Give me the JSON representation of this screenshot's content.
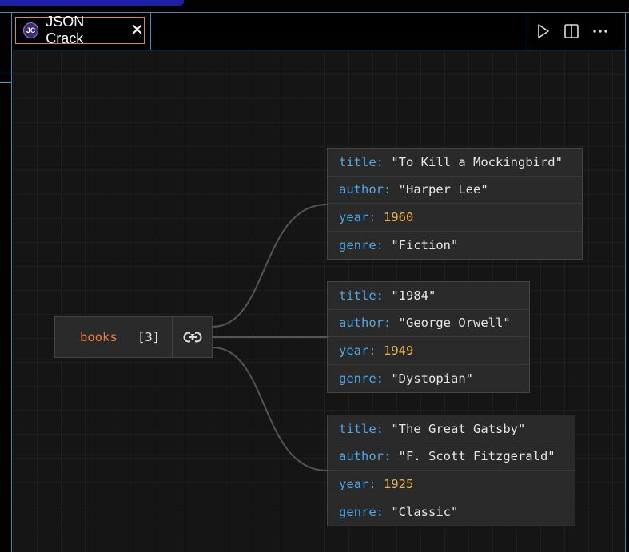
{
  "tab": {
    "logo_text": "JC",
    "title": "JSON Crack",
    "close_glyph": "✕"
  },
  "actions": [
    "play-icon",
    "split-editor-icon",
    "more-icon"
  ],
  "parent_node": {
    "name": "books",
    "count": "[3]"
  },
  "books": [
    {
      "title_key": "title:",
      "title": "\"To Kill a Mockingbird\"",
      "author_key": "author:",
      "author": "\"Harper Lee\"",
      "year_key": "year:",
      "year": "1960",
      "genre_key": "genre:",
      "genre": "\"Fiction\""
    },
    {
      "title_key": "title:",
      "title": "\"1984\"",
      "author_key": "author:",
      "author": "\"George Orwell\"",
      "year_key": "year:",
      "year": "1949",
      "genre_key": "genre:",
      "genre": "\"Dystopian\""
    },
    {
      "title_key": "title:",
      "title": "\"The Great Gatsby\"",
      "author_key": "author:",
      "author": "\"F. Scott Fitzgerald\"",
      "year_key": "year:",
      "year": "1925",
      "genre_key": "genre:",
      "genre": "\"Classic\""
    }
  ],
  "colors": {
    "key": "#4fa8e8",
    "string": "#e6e6e6",
    "number": "#e8b34a",
    "parent_name": "#f07b3f",
    "tab_border": "#d8855a"
  }
}
